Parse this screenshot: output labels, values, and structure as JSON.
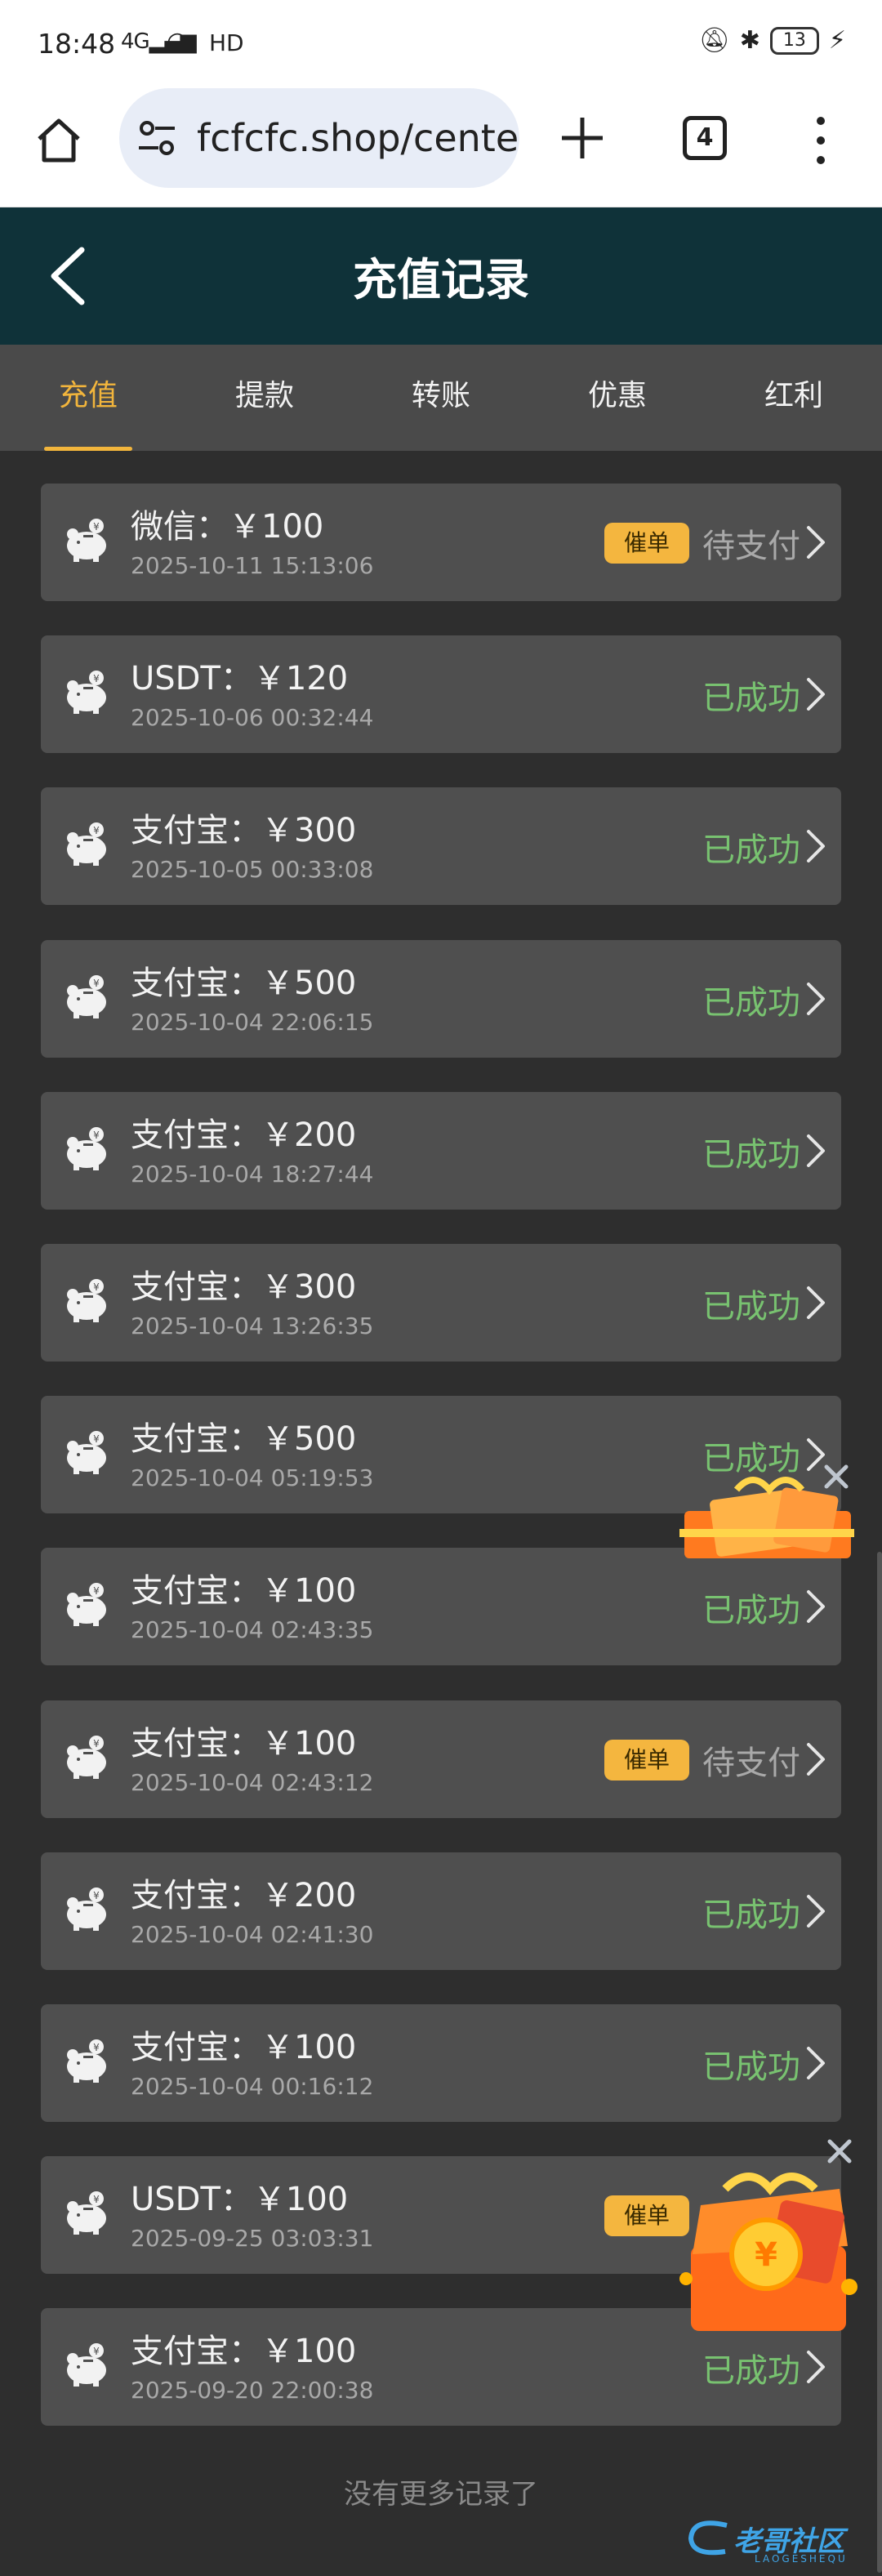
{
  "statusbar": {
    "time": "18:48",
    "signal": "4G",
    "hd": "HD",
    "battery": "13"
  },
  "browser": {
    "url": "fcfcfc.shop/cente",
    "tab_count": "4"
  },
  "header": {
    "title": "充值记录"
  },
  "tabs": [
    {
      "label": "充值",
      "active": true
    },
    {
      "label": "提款",
      "active": false
    },
    {
      "label": "转账",
      "active": false
    },
    {
      "label": "优惠",
      "active": false
    },
    {
      "label": "红利",
      "active": false
    }
  ],
  "records": [
    {
      "amount": "微信：￥100",
      "date": "2025-10-11 15:13:06",
      "status": "待支付",
      "badge": "催单"
    },
    {
      "amount": "USDT：￥120",
      "date": "2025-10-06 00:32:44",
      "status": "已成功",
      "badge": ""
    },
    {
      "amount": "支付宝：￥300",
      "date": "2025-10-05 00:33:08",
      "status": "已成功",
      "badge": ""
    },
    {
      "amount": "支付宝：￥500",
      "date": "2025-10-04 22:06:15",
      "status": "已成功",
      "badge": ""
    },
    {
      "amount": "支付宝：￥200",
      "date": "2025-10-04 18:27:44",
      "status": "已成功",
      "badge": ""
    },
    {
      "amount": "支付宝：￥300",
      "date": "2025-10-04 13:26:35",
      "status": "已成功",
      "badge": ""
    },
    {
      "amount": "支付宝：￥500",
      "date": "2025-10-04 05:19:53",
      "status": "已成功",
      "badge": ""
    },
    {
      "amount": "支付宝：￥100",
      "date": "2025-10-04 02:43:35",
      "status": "已成功",
      "badge": ""
    },
    {
      "amount": "支付宝：￥100",
      "date": "2025-10-04 02:43:12",
      "status": "待支付",
      "badge": "催单"
    },
    {
      "amount": "支付宝：￥200",
      "date": "2025-10-04 02:41:30",
      "status": "已成功",
      "badge": ""
    },
    {
      "amount": "支付宝：￥100",
      "date": "2025-10-04 00:16:12",
      "status": "已成功",
      "badge": ""
    },
    {
      "amount": "USDT：￥100",
      "date": "2025-09-25 03:03:31",
      "status": "",
      "badge": "催单"
    },
    {
      "amount": "支付宝：￥100",
      "date": "2025-09-20 22:00:38",
      "status": "已成功",
      "badge": ""
    }
  ],
  "footer": {
    "no_more": "没有更多记录了"
  },
  "watermark": {
    "text": "老哥社区",
    "sub": "LAOGESHEQU"
  },
  "colors": {
    "header_bg": "#0f3239",
    "tab_active": "#f2b53c",
    "status_ok": "#78c270",
    "status_pending": "#a9a9a9",
    "badge_bg": "#f4b63f",
    "card_bg": "#4f4f4f",
    "page_bg": "#2e2e2e"
  },
  "icons": {
    "record": "piggy-bank-icon",
    "chevron": "chevron-right-icon",
    "back": "back-arrow-icon"
  }
}
